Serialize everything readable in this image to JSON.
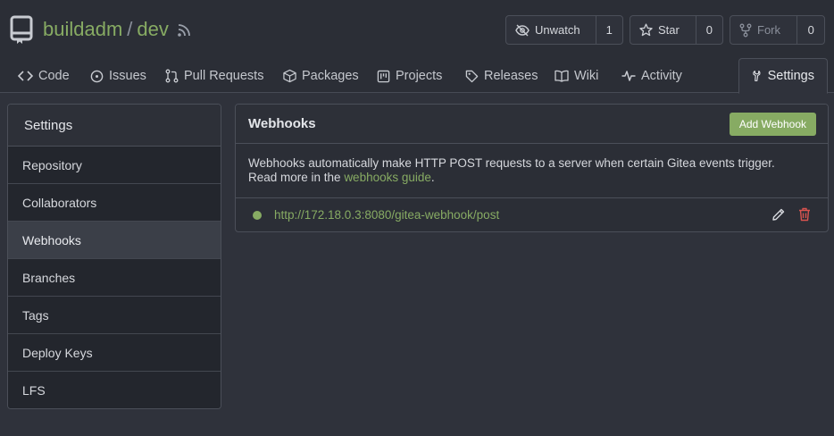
{
  "repo": {
    "owner": "buildadm",
    "separator": "/",
    "name": "dev"
  },
  "actions": {
    "watch": {
      "label": "Unwatch",
      "count": "1"
    },
    "star": {
      "label": "Star",
      "count": "0"
    },
    "fork": {
      "label": "Fork",
      "count": "0"
    }
  },
  "tabs": [
    {
      "label": "Code",
      "icon": "code-icon"
    },
    {
      "label": "Issues",
      "icon": "issue-icon"
    },
    {
      "label": "Pull Requests",
      "icon": "pull-request-icon"
    },
    {
      "label": "Packages",
      "icon": "package-icon"
    },
    {
      "label": "Projects",
      "icon": "project-icon"
    },
    {
      "label": "Releases",
      "icon": "tag-icon"
    },
    {
      "label": "Wiki",
      "icon": "book-icon"
    },
    {
      "label": "Activity",
      "icon": "pulse-icon"
    },
    {
      "label": "Settings",
      "icon": "tools-icon",
      "active": true
    }
  ],
  "sidebar": {
    "title": "Settings",
    "items": [
      {
        "label": "Repository"
      },
      {
        "label": "Collaborators"
      },
      {
        "label": "Webhooks",
        "active": true
      },
      {
        "label": "Branches"
      },
      {
        "label": "Tags"
      },
      {
        "label": "Deploy Keys"
      },
      {
        "label": "LFS"
      }
    ]
  },
  "webhooks": {
    "title": "Webhooks",
    "add_label": "Add Webhook",
    "desc_line1": "Webhooks automatically make HTTP POST requests to a server when certain Gitea events trigger.",
    "desc_prefix": "Read more in the ",
    "desc_link": "webhooks guide",
    "desc_suffix": ".",
    "hooks": [
      {
        "url": "http://172.18.0.3:8080/gitea-webhook/post",
        "status": "active"
      }
    ]
  },
  "colors": {
    "accent": "#87ab63",
    "danger": "#d9534f",
    "bg": "#2f323b"
  }
}
